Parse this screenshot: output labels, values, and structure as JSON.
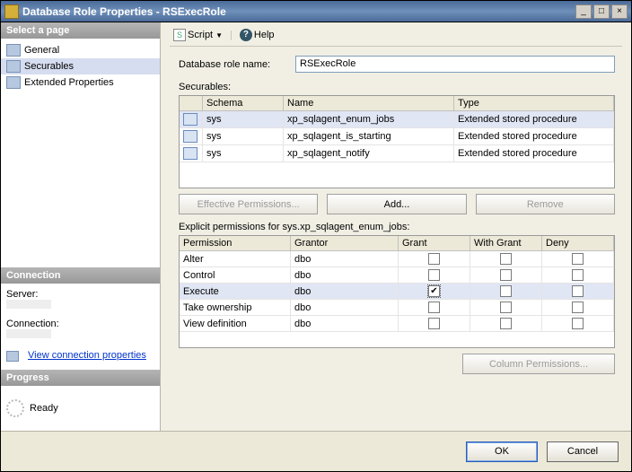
{
  "window": {
    "title": "Database Role Properties - RSExecRole"
  },
  "toolbar": {
    "script": "Script",
    "help": "Help"
  },
  "sidebar": {
    "selectPage": "Select a page",
    "items": [
      {
        "label": "General"
      },
      {
        "label": "Securables"
      },
      {
        "label": "Extended Properties"
      }
    ],
    "connection": {
      "header": "Connection",
      "serverLbl": "Server:",
      "connLbl": "Connection:",
      "viewProps": "View connection properties"
    },
    "progress": {
      "header": "Progress",
      "status": "Ready"
    }
  },
  "form": {
    "roleNameLbl": "Database role name:",
    "roleName": "RSExecRole",
    "securablesLbl": "Securables:",
    "cols": {
      "schema": "Schema",
      "name": "Name",
      "type": "Type"
    },
    "rows": [
      {
        "schema": "sys",
        "name": "xp_sqlagent_enum_jobs",
        "type": "Extended stored procedure"
      },
      {
        "schema": "sys",
        "name": "xp_sqlagent_is_starting",
        "type": "Extended stored procedure"
      },
      {
        "schema": "sys",
        "name": "xp_sqlagent_notify",
        "type": "Extended stored procedure"
      }
    ],
    "buttons": {
      "effective": "Effective Permissions...",
      "add": "Add...",
      "remove": "Remove"
    },
    "exPrefix": "Explicit permissions for sys.xp_sqlagent_enum_jobs:",
    "pcols": {
      "perm": "Permission",
      "grantor": "Grantor",
      "grant": "Grant",
      "withGrant": "With Grant",
      "deny": "Deny"
    },
    "perms": [
      {
        "p": "Alter",
        "g": "dbo",
        "grant": false,
        "with": false,
        "deny": false
      },
      {
        "p": "Control",
        "g": "dbo",
        "grant": false,
        "with": false,
        "deny": false
      },
      {
        "p": "Execute",
        "g": "dbo",
        "grant": true,
        "with": false,
        "deny": false
      },
      {
        "p": "Take ownership",
        "g": "dbo",
        "grant": false,
        "with": false,
        "deny": false
      },
      {
        "p": "View definition",
        "g": "dbo",
        "grant": false,
        "with": false,
        "deny": false
      }
    ],
    "colPerm": "Column Permissions..."
  },
  "footer": {
    "ok": "OK",
    "cancel": "Cancel"
  }
}
